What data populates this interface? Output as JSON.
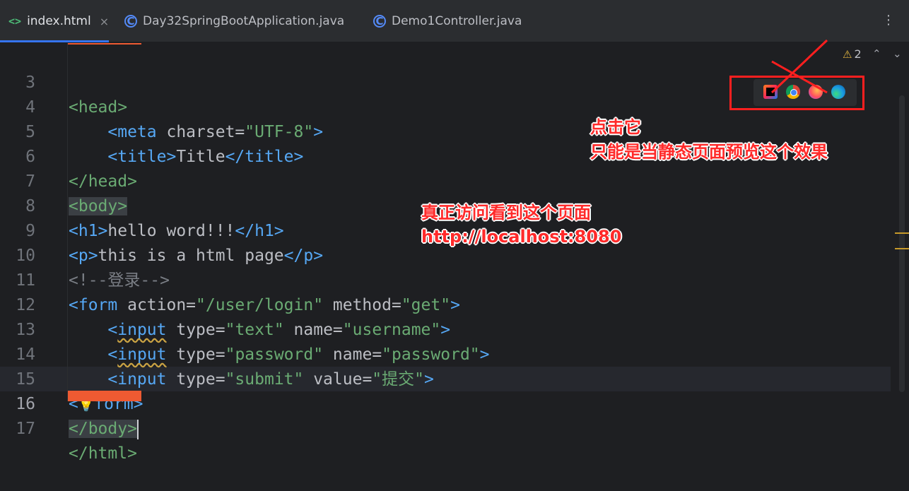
{
  "tabs": [
    {
      "label": "index.html",
      "icon": "html-icon",
      "active": true
    },
    {
      "label": "Day32SpringBootApplication.java",
      "icon": "java-class-icon"
    },
    {
      "label": "Demo1Controller.java",
      "icon": "java-class-icon"
    }
  ],
  "editor": {
    "warning_count": "2",
    "lines": [
      {
        "num": "3"
      },
      {
        "num": "4"
      },
      {
        "num": "5"
      },
      {
        "num": "6"
      },
      {
        "num": "7"
      },
      {
        "num": "8"
      },
      {
        "num": "9"
      },
      {
        "num": "10"
      },
      {
        "num": "11"
      },
      {
        "num": "12"
      },
      {
        "num": "13"
      },
      {
        "num": "14"
      },
      {
        "num": "15"
      },
      {
        "num": "16"
      },
      {
        "num": "17"
      }
    ],
    "code": {
      "l3_tag": "<head>",
      "l4_open": "<meta",
      "l4_attr": " charset=",
      "l4_val": "\"UTF-8\"",
      "l4_close": ">",
      "l5_open": "<title>",
      "l5_text": "Title",
      "l5_close": "</title>",
      "l6_tag": "</head>",
      "l7_tag": "<body>",
      "l8_open": "<h1>",
      "l8_text": "hello word!!!",
      "l8_close": "</h1>",
      "l9_open": "<p>",
      "l9_text": "this is a html page",
      "l9_close": "</p>",
      "l10_comment": "<!--登录-->",
      "l11_open": "<form",
      "l11_attr1": " action=",
      "l11_val1": "\"/user/login\"",
      "l11_attr2": " method=",
      "l11_val2": "\"get\"",
      "l11_close": ">",
      "l12_lt": "<",
      "l12_tag": "input",
      "l12_attr1": " type=",
      "l12_val1": "\"text\"",
      "l12_attr2": " name=",
      "l12_val2": "\"username\"",
      "l12_close": ">",
      "l13_lt": "<",
      "l13_tag": "input",
      "l13_attr1": " type=",
      "l13_val1": "\"password\"",
      "l13_attr2": " name=",
      "l13_val2": "\"password\"",
      "l13_close": ">",
      "l14_open": "<input",
      "l14_attr1": " type=",
      "l14_val1": "\"submit\"",
      "l14_attr2": " value=",
      "l14_val2": "\"提交\"",
      "l14_close": ">",
      "l15_lt": "<",
      "l15_tag": "form>",
      "l16_tag": "</body>",
      "l17_tag": "</html>"
    }
  },
  "browser_icons": [
    "intellij-icon",
    "chrome-icon",
    "firefox-icon",
    "edge-icon"
  ],
  "annotations": {
    "click_it": "点击它",
    "static_preview_only": "只能是当静态页面预览这个效果",
    "real_access": "真正访问看到这个页面",
    "url": "http://localhost:8080"
  },
  "colors": {
    "annotation": "#ff2a2a",
    "tab_underline": "#3574f0",
    "tag": "#56a8f5",
    "string": "#6aab73"
  }
}
